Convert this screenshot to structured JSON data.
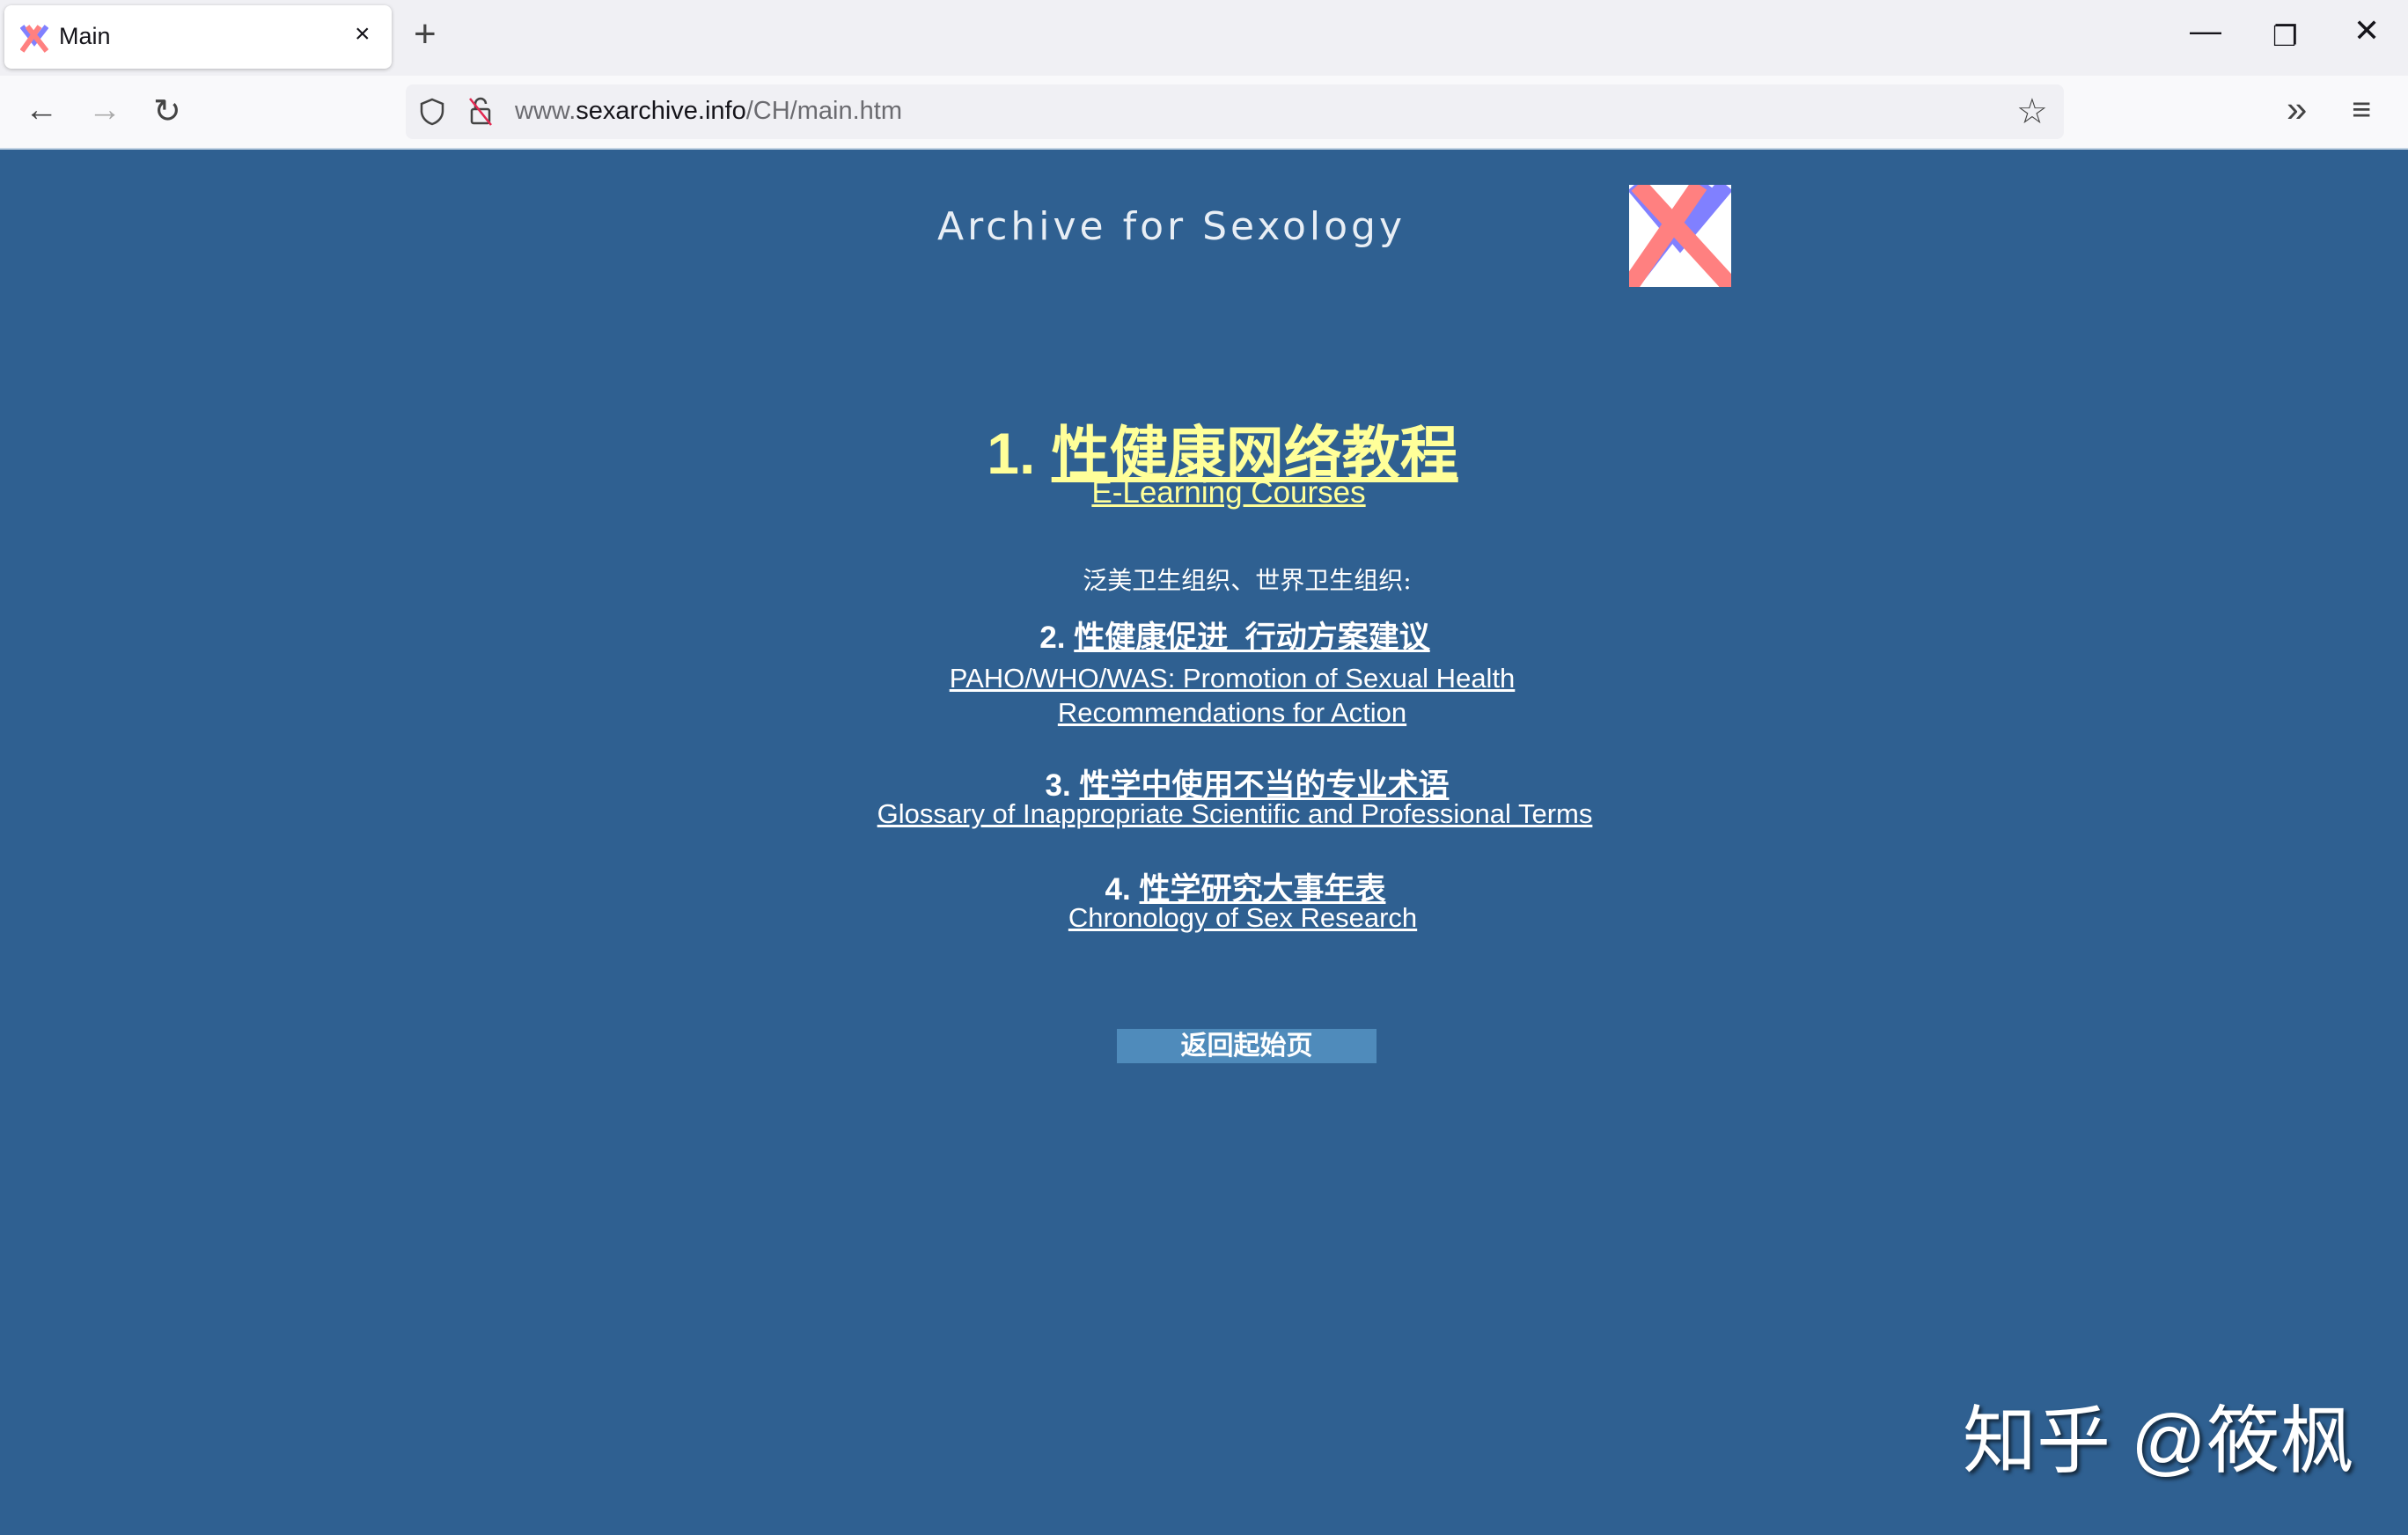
{
  "browser": {
    "tab_title": "Main",
    "tab_close": "×",
    "new_tab": "+",
    "url_domain_prefix": "www.",
    "url_domain": "sexarchive.info",
    "url_path": "/CH/main.htm",
    "icons": [
      "favicon-x-logo",
      "close-icon",
      "plus-icon",
      "minimize-icon",
      "restore-icon",
      "window-close-icon",
      "back-arrow-icon",
      "forward-arrow-icon",
      "reload-icon",
      "shield-icon",
      "insecure-lock-icon",
      "star-icon",
      "chevrons-right-icon",
      "hamburger-menu-icon"
    ]
  },
  "page": {
    "site_title": "Archive for Sexology",
    "colors": {
      "background": "#2f6091",
      "accent_yellow": "#ffff99",
      "button": "#4f8bbb",
      "logo_blue": "#8080ff",
      "logo_red": "#ff8080"
    },
    "item1": {
      "number": "1.",
      "title": "性健康网络教程",
      "subtitle": "E-Learning Courses"
    },
    "orgs_label": "泛美卫生组织、世界卫生组织:",
    "item2": {
      "number": "2.",
      "title": "性健康促进_行动方案建议",
      "subtitle_line1": "PAHO/WHO/WAS: Promotion of Sexual Health",
      "subtitle_line2": "Recommendations for Action"
    },
    "item3": {
      "number": "3.",
      "title": "性学中使用不当的专业术语",
      "subtitle": "Glossary of Inappropriate Scientific and Professional Terms"
    },
    "item4": {
      "number": "4.",
      "title": "性学研究大事年表",
      "subtitle": "Chronology of Sex Research"
    },
    "back_button": "返回起始页"
  },
  "watermark": "知乎 @筱枫"
}
